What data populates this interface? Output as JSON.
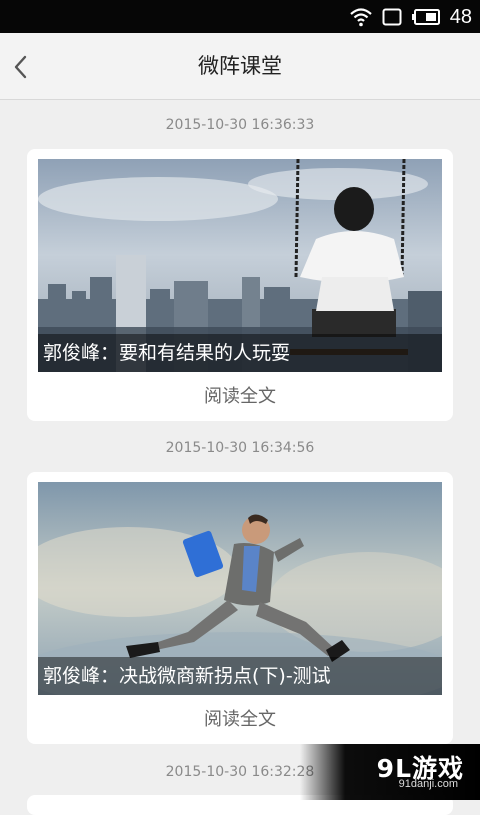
{
  "status_bar": {
    "battery_level": "48"
  },
  "nav": {
    "title": "微阵课堂",
    "back_icon": "chevron-left-icon"
  },
  "feed": [
    {
      "timestamp": "2015-10-30 16:36:33",
      "caption": "郭俊峰：要和有结果的人玩耍",
      "read_more": "阅读全文"
    },
    {
      "timestamp": "2015-10-30 16:34:56",
      "caption": "郭俊峰：决战微商新拐点(下)-测试",
      "read_more": "阅读全文"
    },
    {
      "timestamp": "2015-10-30 16:32:28"
    }
  ],
  "watermark": {
    "logo": "9L游戏",
    "site": "91danji.com"
  },
  "colors": {
    "background": "#efefef",
    "card": "#ffffff",
    "timestamp": "#8a8a8a",
    "status_bar": "#060606"
  }
}
